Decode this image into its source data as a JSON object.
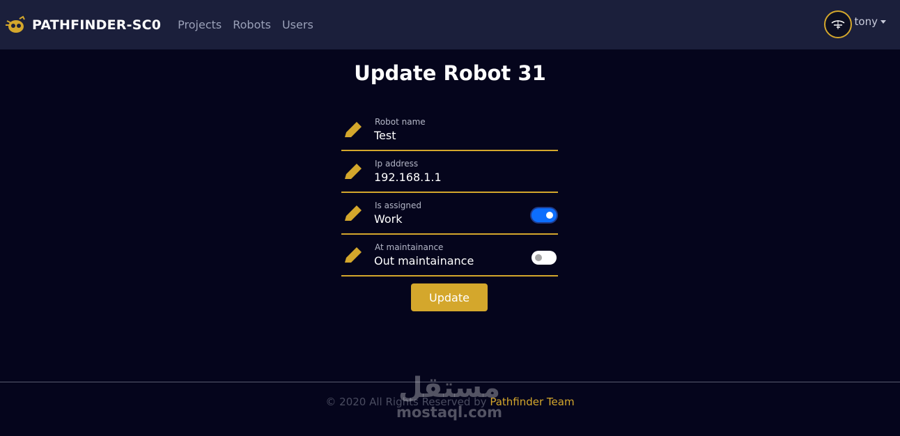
{
  "navbar": {
    "brand": "PATHFINDER-SC0",
    "links": [
      "Projects",
      "Robots",
      "Users"
    ],
    "user": "tony"
  },
  "page": {
    "title": "Update Robot 31"
  },
  "form": {
    "fields": [
      {
        "label": "Robot name",
        "value": "Test"
      },
      {
        "label": "Ip address",
        "value": "192.168.1.1"
      },
      {
        "label": "Is assigned",
        "value": "Work",
        "toggle": true
      },
      {
        "label": "At maintainance",
        "value": "Out maintainance",
        "toggle": false
      }
    ],
    "submit_label": "Update"
  },
  "footer": {
    "copyright": "© 2020 All Rights Reserved by",
    "team": "Pathfinder Team"
  },
  "watermark": {
    "arabic": "مستقل",
    "latin": "mostaql.com"
  },
  "colors": {
    "accent": "#d4a72c",
    "navbar_bg": "#1b1f3b",
    "page_bg": "#05051c",
    "toggle_on": "#0d6efd"
  },
  "icons": [
    "robot-logo-icon",
    "pencil-icon",
    "avatar-icon",
    "caret-down-icon"
  ]
}
